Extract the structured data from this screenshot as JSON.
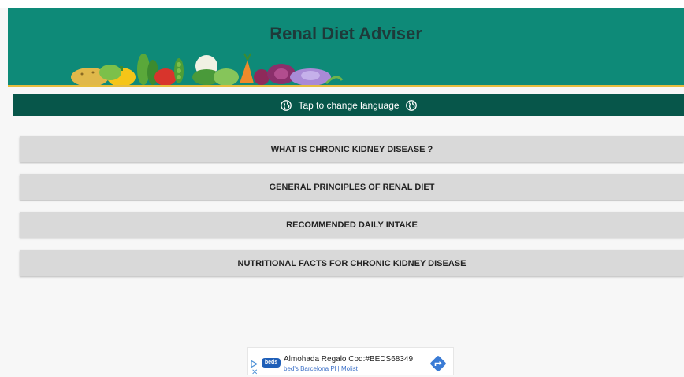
{
  "app": {
    "title": "Renal Diet Adviser"
  },
  "language_bar": {
    "label": "Tap to change language"
  },
  "menu": [
    {
      "label": "WHAT IS CHRONIC KIDNEY DISEASE ?"
    },
    {
      "label": "GENERAL PRINCIPLES OF RENAL DIET"
    },
    {
      "label": "RECOMMENDED DAILY INTAKE"
    },
    {
      "label": "NUTRITIONAL FACTS FOR CHRONIC KIDNEY DISEASE"
    }
  ],
  "ad": {
    "logo_text": "beds",
    "headline": "Almohada Regalo Cod:#BEDS68349",
    "subline": "bed's Barcelona Pl | Molist",
    "icons": [
      "adchoices-icon",
      "close-icon",
      "directions-icon"
    ]
  },
  "colors": {
    "header_bg": "#0e8a78",
    "language_bar_bg": "#07564a",
    "accent_line": "#e6bd3f",
    "button_bg": "#d9d9d9",
    "page_bg": "#f7f7f7"
  }
}
